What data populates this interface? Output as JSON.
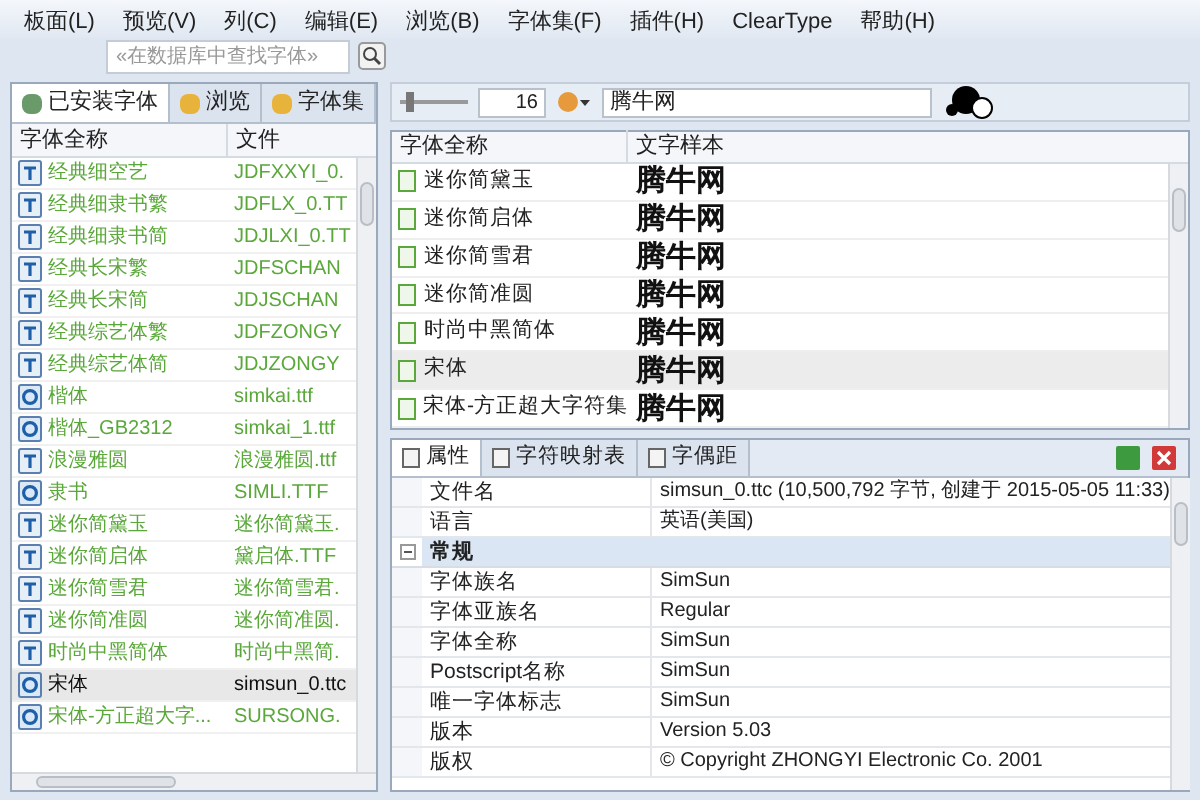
{
  "menu": [
    "板面(L)",
    "预览(V)",
    "列(C)",
    "编辑(E)",
    "浏览(B)",
    "字体集(F)",
    "插件(H)",
    "ClearType",
    "帮助(H)"
  ],
  "search": {
    "placeholder": "«在数据库中查找字体»"
  },
  "left_tabs": [
    {
      "label": "已安装字体",
      "selected": true
    },
    {
      "label": "浏览",
      "selected": false
    },
    {
      "label": "字体集",
      "selected": false
    }
  ],
  "font_table": {
    "columns": [
      "字体全称",
      "文件"
    ],
    "rows": [
      {
        "name": "经典细空艺",
        "file": "JDFXXYI_0.",
        "kind": "tt",
        "selected": false
      },
      {
        "name": "经典细隶书繁",
        "file": "JDFLX_0.TT",
        "kind": "tt",
        "selected": false
      },
      {
        "name": "经典细隶书简",
        "file": "JDJLXI_0.TT",
        "kind": "tt",
        "selected": false
      },
      {
        "name": "经典长宋繁",
        "file": "JDFSCHAN",
        "kind": "tt",
        "selected": false
      },
      {
        "name": "经典长宋简",
        "file": "JDJSCHAN",
        "kind": "tt",
        "selected": false
      },
      {
        "name": "经典综艺体繁",
        "file": "JDFZONGY",
        "kind": "tt",
        "selected": false
      },
      {
        "name": "经典综艺体简",
        "file": "JDJZONGY",
        "kind": "tt",
        "selected": false
      },
      {
        "name": "楷体",
        "file": "simkai.ttf",
        "kind": "ot",
        "selected": false
      },
      {
        "name": "楷体_GB2312",
        "file": "simkai_1.ttf",
        "kind": "ot",
        "selected": false
      },
      {
        "name": "浪漫雅圆",
        "file": "浪漫雅圆.ttf",
        "kind": "tt",
        "selected": false
      },
      {
        "name": "隶书",
        "file": "SIMLI.TTF",
        "kind": "ot",
        "selected": false
      },
      {
        "name": "迷你简黛玉",
        "file": "迷你简黛玉.",
        "kind": "tt",
        "selected": false
      },
      {
        "name": "迷你简启体",
        "file": "黛启体.TTF",
        "kind": "tt",
        "selected": false
      },
      {
        "name": "迷你简雪君",
        "file": "迷你简雪君.",
        "kind": "tt",
        "selected": false
      },
      {
        "name": "迷你简准圆",
        "file": "迷你简准圆.",
        "kind": "tt",
        "selected": false
      },
      {
        "name": "时尚中黑简体",
        "file": "时尚中黑简.",
        "kind": "tt",
        "selected": false
      },
      {
        "name": "宋体",
        "file": "simsun_0.ttc",
        "kind": "ot",
        "selected": true
      },
      {
        "name": "宋体-方正超大字...",
        "file": "SURSONG.",
        "kind": "ot",
        "selected": false
      }
    ]
  },
  "toolbar": {
    "size": "16",
    "sample_text": "腾牛网",
    "slider": {
      "level": 0.1
    }
  },
  "preview_table": {
    "columns": [
      "字体全称",
      "文字样本"
    ],
    "rows": [
      {
        "name": "迷你简黛玉",
        "sample": "腾牛网",
        "selected": false
      },
      {
        "name": "迷你简启体",
        "sample": "腾牛网",
        "selected": false
      },
      {
        "name": "迷你简雪君",
        "sample": "腾牛网",
        "selected": false
      },
      {
        "name": "迷你简准圆",
        "sample": "腾牛网",
        "selected": false
      },
      {
        "name": "时尚中黑简体",
        "sample": "腾牛网",
        "selected": false
      },
      {
        "name": "宋体",
        "sample": "腾牛网",
        "selected": true
      },
      {
        "name": "宋体-方正超大字符集",
        "sample": "腾牛网",
        "selected": false
      }
    ]
  },
  "prop_tabs": [
    {
      "label": "属性",
      "selected": true
    },
    {
      "label": "字符映射表",
      "selected": false
    },
    {
      "label": "字偶距",
      "selected": false
    }
  ],
  "properties": [
    {
      "kind": "row",
      "key": "文件名",
      "value": "simsun_0.ttc (10,500,792 字节, 创建于 2015-05-05 11:33)"
    },
    {
      "kind": "row",
      "key": "语言",
      "value": "英语(美国)"
    },
    {
      "kind": "group",
      "key": "常规",
      "expanded": true
    },
    {
      "kind": "row",
      "key": "字体族名",
      "value": "SimSun"
    },
    {
      "kind": "row",
      "key": "字体亚族名",
      "value": "Regular"
    },
    {
      "kind": "row",
      "key": "字体全称",
      "value": "SimSun"
    },
    {
      "kind": "row",
      "key": "Postscript名称",
      "value": "SimSun"
    },
    {
      "kind": "row",
      "key": "唯一字体标志",
      "value": "SimSun"
    },
    {
      "kind": "row",
      "key": "版本",
      "value": "Version 5.03"
    },
    {
      "kind": "row",
      "key": "版权",
      "value": "© Copyright ZHONGYI Electronic Co. 2001"
    }
  ]
}
